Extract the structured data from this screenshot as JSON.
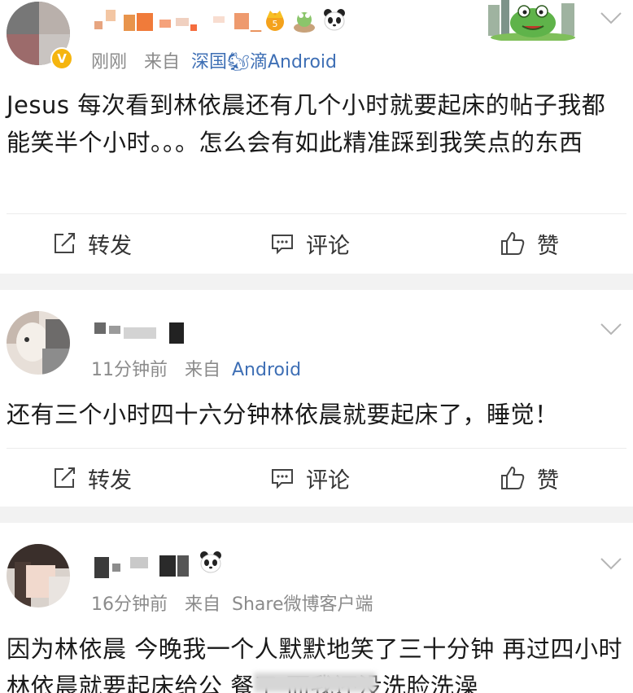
{
  "posts": [
    {
      "time": "刚刚",
      "source_prefix": "来自",
      "source": "深国🐿滴Android",
      "text": "Jesus 每次看到林依晨还有几个小时就要起床的帖子我都能笑半个小时。。。怎么会有如此精准踩到我笑点的东西",
      "name_suffix": "_"
    },
    {
      "time": "11分钟前",
      "source_prefix": "来自",
      "source": "Android",
      "text": "还有三个小时四十六分钟林依晨就要起床了，睡觉！"
    },
    {
      "time": "16分钟前",
      "source_prefix": "来自",
      "source": "Share微博客户端",
      "text": "因为林依晨 今晚我一个人默默地笑了三十分钟 再过四小时林依晨就要起床给公      餐了 而我还没洗脸洗澡"
    }
  ],
  "actions": {
    "repost": "转发",
    "comment": "评论",
    "like": "赞"
  },
  "badge_level": "5",
  "colors": {
    "source_link": "#3e6fb5",
    "meta_gray": "#8b8b8b",
    "separator": "#f2f2f2",
    "verified_badge": "#f5b50f"
  },
  "icons": [
    "repost-icon",
    "comment-icon",
    "like-icon",
    "chevron-down-icon",
    "panda-emoji-icon",
    "crown-badge-icon",
    "verified-badge-icon",
    "frog-sticker-icon"
  ]
}
